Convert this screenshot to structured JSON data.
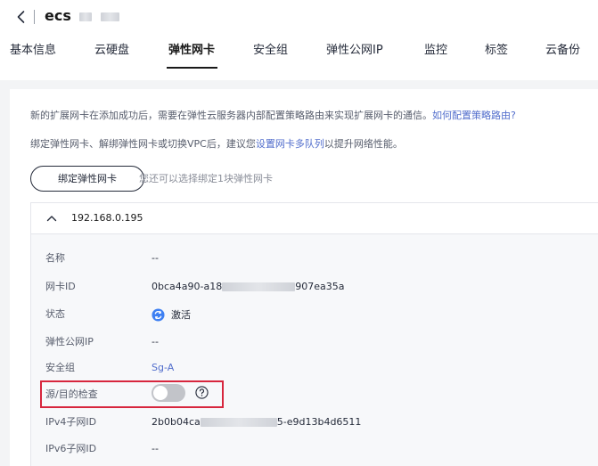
{
  "header": {
    "title": "ecs",
    "back_icon": "chevron-left-icon"
  },
  "tabs": [
    {
      "label": "基本信息",
      "active": false
    },
    {
      "label": "云硬盘",
      "active": false
    },
    {
      "label": "弹性网卡",
      "active": true
    },
    {
      "label": "安全组",
      "active": false
    },
    {
      "label": "弹性公网IP",
      "active": false
    },
    {
      "label": "监控",
      "active": false
    },
    {
      "label": "标签",
      "active": false
    },
    {
      "label": "云备份",
      "active": false
    }
  ],
  "notice": {
    "line1_text": "新的扩展网卡在添加成功后，需要在弹性云服务器内部配置策略路由来实现扩展网卡的通信。",
    "line1_link": "如何配置策略路由?",
    "line2_prefix": "绑定弹性网卡、解绑弹性网卡或切换VPC后，建议您",
    "line2_link": "设置网卡多队列",
    "line2_suffix": "以提升网络性能。"
  },
  "actions": {
    "bind_button": "绑定弹性网卡",
    "bind_hint": "您还可以选择绑定1块弹性网卡"
  },
  "nic": {
    "ip": "192.168.0.195",
    "expanded": true,
    "fields": {
      "name_label": "名称",
      "name_value": "--",
      "nic_id_label": "网卡ID",
      "nic_id_prefix": "0bca4a90-a18",
      "nic_id_suffix": "907ea35a",
      "status_label": "状态",
      "status_value": "激活",
      "eip_label": "弹性公网IP",
      "eip_value": "--",
      "sg_label": "安全组",
      "sg_value": "Sg-A",
      "src_dst_label": "源/目的检查",
      "src_dst_enabled": false,
      "ipv4_label": "IPv4子网ID",
      "ipv4_prefix": "2b0b04ca",
      "ipv4_suffix": "5-e9d13b4d6511",
      "ipv6_label": "IPv6子网ID",
      "ipv6_value": "--"
    }
  },
  "colors": {
    "link": "#526ecc",
    "status_active": "#3e80f2",
    "highlight": "#d7263d",
    "toggle_off": "#c2c4c9"
  }
}
